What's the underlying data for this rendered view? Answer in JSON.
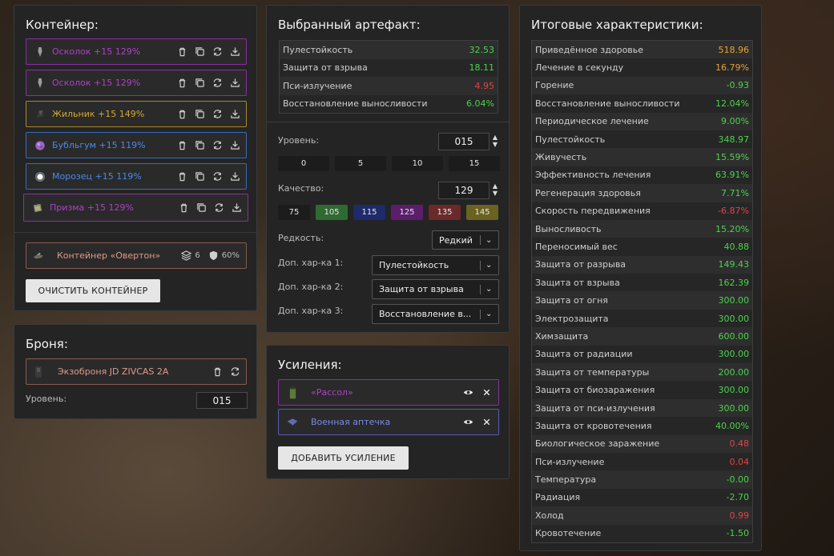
{
  "container": {
    "title": "Контейнер:",
    "artifacts": [
      {
        "name": "Осколок +15 129%",
        "color": "#b040c8",
        "border": "#8a2fa0"
      },
      {
        "name": "Осколок +15 129%",
        "color": "#b040c8",
        "border": "#8a2fa0"
      },
      {
        "name": "Жильник +15 149%",
        "color": "#d4a830",
        "border": "#a8882a"
      },
      {
        "name": "Бубльгум +15 119%",
        "color": "#4a8ae6",
        "border": "#3a6ab8"
      },
      {
        "name": "Морозец +15 119%",
        "color": "#4a8ae6",
        "border": "#3a6ab8"
      },
      {
        "name": "Призма +15 129%",
        "color": "#b040c8",
        "border": "#8a2fa0"
      }
    ],
    "container_item": {
      "name": "Контейнер «Овертон»",
      "slots": "6",
      "protection": "60%"
    },
    "clear_label": "ОЧИСТИТЬ КОНТЕЙНЕР"
  },
  "armor": {
    "title": "Броня:",
    "name": "Экзоброня JD ZIVCAS 2A",
    "level_label": "Уровень:",
    "level_value": "015"
  },
  "selected": {
    "title": "Выбранный артефакт:",
    "stats": [
      {
        "k": "Пулестойкость",
        "v": "32.53",
        "c": "green"
      },
      {
        "k": "Защита от взрыва",
        "v": "18.11",
        "c": "green"
      },
      {
        "k": "Пси-излучение",
        "v": "4.95",
        "c": "red"
      },
      {
        "k": "Восстановление выносливости",
        "v": "6.04%",
        "c": "green"
      }
    ],
    "level_label": "Уровень:",
    "level_value": "015",
    "level_presets": [
      "0",
      "5",
      "10",
      "15"
    ],
    "quality_label": "Качество:",
    "quality_value": "129",
    "quality_presets": [
      {
        "v": "75",
        "bg": "#1c1c1c"
      },
      {
        "v": "105",
        "bg": "#2f6a32"
      },
      {
        "v": "115",
        "bg": "#1e2a6a"
      },
      {
        "v": "125",
        "bg": "#5a1e6a"
      },
      {
        "v": "135",
        "bg": "#6a2a2a"
      },
      {
        "v": "145",
        "bg": "#6a6220"
      }
    ],
    "rarity_label": "Редкость:",
    "rarity_value": "Редкий",
    "add1_label": "Доп. хар-ка 1:",
    "add1_value": "Пулестойкость",
    "add2_label": "Доп. хар-ка 2:",
    "add2_value": "Защита от взрыва",
    "add3_label": "Доп. хар-ка 3:",
    "add3_value": "Восстановление в..."
  },
  "boosts": {
    "title": "Усиления:",
    "items": [
      {
        "name": "«Рассол»",
        "color": "#b040c8",
        "border": "#8a2fa0"
      },
      {
        "name": "Военная аптечка",
        "color": "#7a8ae6",
        "border": "#5a5ab8"
      }
    ],
    "add_label": "ДОБАВИТЬ УСИЛЕНИЕ"
  },
  "totals": {
    "title": "Итоговые характеристики:",
    "stats": [
      {
        "k": "Приведённое здоровье",
        "v": "518.96",
        "c": "orange"
      },
      {
        "k": "Лечение в секунду",
        "v": "16.79%",
        "c": "orange"
      },
      {
        "k": "Горение",
        "v": "-0.93",
        "c": "green"
      },
      {
        "k": "Восстановление выносливости",
        "v": "12.04%",
        "c": "green"
      },
      {
        "k": "Периодическое лечение",
        "v": "9.00%",
        "c": "green"
      },
      {
        "k": "Пулестойкость",
        "v": "348.97",
        "c": "green"
      },
      {
        "k": "Живучесть",
        "v": "15.59%",
        "c": "green"
      },
      {
        "k": "Эффективность лечения",
        "v": "63.91%",
        "c": "green"
      },
      {
        "k": "Регенерация здоровья",
        "v": "7.71%",
        "c": "green"
      },
      {
        "k": "Скорость передвижения",
        "v": "-6.87%",
        "c": "red"
      },
      {
        "k": "Выносливость",
        "v": "15.20%",
        "c": "green"
      },
      {
        "k": "Переносимый вес",
        "v": "40.88",
        "c": "green"
      },
      {
        "k": "Защита от разрыва",
        "v": "149.43",
        "c": "green"
      },
      {
        "k": "Защита от взрыва",
        "v": "162.39",
        "c": "green"
      },
      {
        "k": "Защита от огня",
        "v": "300.00",
        "c": "green"
      },
      {
        "k": "Электрозащита",
        "v": "300.00",
        "c": "green"
      },
      {
        "k": "Химзащита",
        "v": "600.00",
        "c": "green"
      },
      {
        "k": "Защита от радиации",
        "v": "300.00",
        "c": "green"
      },
      {
        "k": "Защита от температуры",
        "v": "200.00",
        "c": "green"
      },
      {
        "k": "Защита от биозаражения",
        "v": "300.00",
        "c": "green"
      },
      {
        "k": "Защита от пси-излучения",
        "v": "300.00",
        "c": "green"
      },
      {
        "k": "Защита от кровотечения",
        "v": "40.00%",
        "c": "green"
      },
      {
        "k": "Биологическое заражение",
        "v": "0.48",
        "c": "red"
      },
      {
        "k": "Пси-излучение",
        "v": "0.04",
        "c": "red"
      },
      {
        "k": "Температура",
        "v": "-0.00",
        "c": "green"
      },
      {
        "k": "Радиация",
        "v": "-2.70",
        "c": "green"
      },
      {
        "k": "Холод",
        "v": "0.99",
        "c": "red"
      },
      {
        "k": "Кровотечение",
        "v": "-1.50",
        "c": "green"
      }
    ]
  }
}
